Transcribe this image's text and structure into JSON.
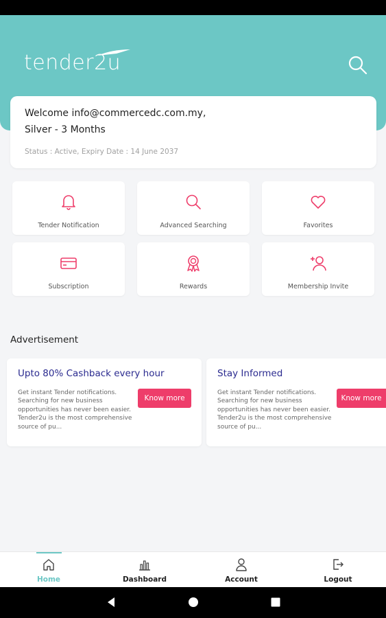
{
  "header": {
    "logo_text": "tender2u"
  },
  "welcome": {
    "greeting": "Welcome info@commercedc.com.my,",
    "plan": "Silver - 3 Months",
    "status": "Status : Active, Expiry Date : 14 June 2037"
  },
  "tiles": [
    {
      "label": "Tender Notification",
      "icon": "bell-icon"
    },
    {
      "label": "Advanced Searching",
      "icon": "search-icon"
    },
    {
      "label": "Favorites",
      "icon": "heart-icon"
    },
    {
      "label": "Subscription",
      "icon": "credit-card-icon"
    },
    {
      "label": "Rewards",
      "icon": "award-icon"
    },
    {
      "label": "Membership Invite",
      "icon": "user-plus-icon"
    }
  ],
  "advertisement": {
    "title": "Advertisement",
    "cards": [
      {
        "title": "Upto 80% Cashback every hour",
        "body": "Get instant Tender notifications. Searching for new business opportunities has never been easier. Tender2u is the most comprehensive source of pu...",
        "button": "Know more"
      },
      {
        "title": "Stay Informed",
        "body": "Get instant Tender notifications. Searching for new business opportunities has never been easier. Tender2u is the most comprehensive source of pu...",
        "button": "Know more"
      }
    ]
  },
  "bottom_nav": [
    {
      "label": "Home",
      "icon": "home-icon",
      "active": true
    },
    {
      "label": "Dashboard",
      "icon": "chart-icon",
      "active": false
    },
    {
      "label": "Account",
      "icon": "user-icon",
      "active": false
    },
    {
      "label": "Logout",
      "icon": "logout-icon",
      "active": false
    }
  ],
  "colors": {
    "header": "#6cc7c5",
    "accent": "#ee3d6a",
    "ad_title": "#2a2a8f",
    "background": "#f4f5f7"
  }
}
